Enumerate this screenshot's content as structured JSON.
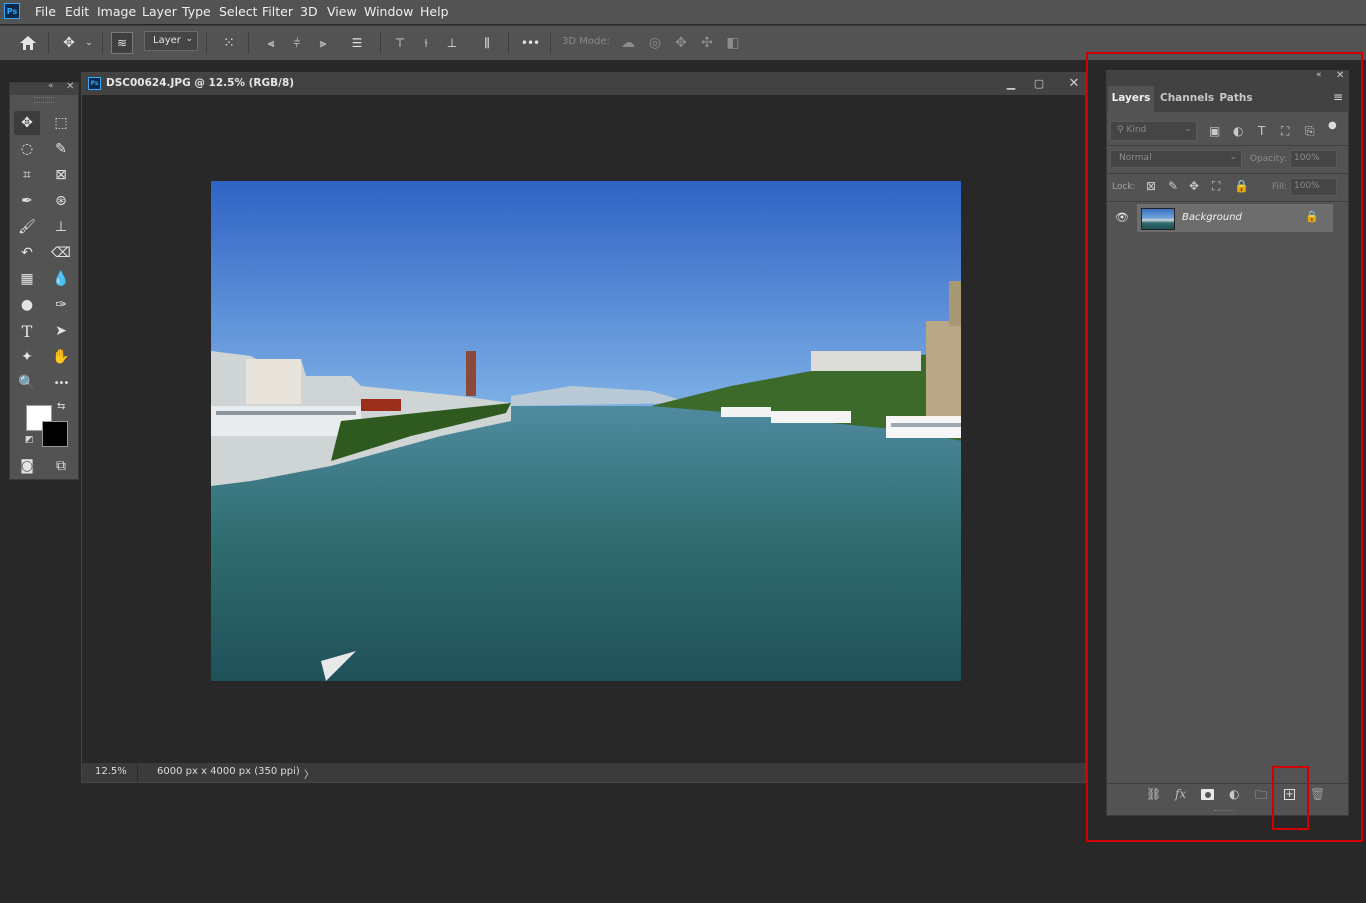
{
  "app": {
    "logo": "Ps"
  },
  "menu": [
    "File",
    "Edit",
    "Image",
    "Layer",
    "Type",
    "Select",
    "Filter",
    "3D",
    "View",
    "Window",
    "Help"
  ],
  "options_bar": {
    "layer_select_value": "Layer",
    "mode_3d_label": "3D Mode:",
    "icons": [
      "home-icon",
      "move-tool-icon",
      "chevron-down-icon",
      "layer-stack-icon",
      "transform-controls-icon",
      "align-left-icon",
      "align-hcenter-icon",
      "align-right-icon",
      "distribute-vertical-icon",
      "align-top-icon",
      "align-vcenter-icon",
      "align-bottom-icon",
      "distribute-horizontal-icon",
      "more-icon",
      "orbit-3d-icon",
      "roll-3d-icon",
      "pan-3d-icon",
      "slide-3d-icon",
      "scale-3d-icon"
    ]
  },
  "document": {
    "title": "DSC00624.JPG @ 12.5% (RGB/8)",
    "zoom": "12.5%",
    "info": "6000 px x 4000 px (350 ppi)",
    "status_arrow": "〉",
    "window_buttons": [
      "minimize-icon",
      "maximize-icon",
      "close-icon"
    ]
  },
  "toolbox": {
    "tools": [
      {
        "name": "move-tool",
        "glyph": "✥",
        "selected": true
      },
      {
        "name": "marquee-tool",
        "glyph": "⬚"
      },
      {
        "name": "lasso-tool",
        "glyph": "◌"
      },
      {
        "name": "quick-selection-tool",
        "glyph": "✎"
      },
      {
        "name": "crop-tool",
        "glyph": "⌗"
      },
      {
        "name": "frame-tool",
        "glyph": "⊠"
      },
      {
        "name": "eyedropper-tool",
        "glyph": "✒"
      },
      {
        "name": "spot-healing-tool",
        "glyph": "⊛"
      },
      {
        "name": "brush-tool",
        "glyph": "🖌"
      },
      {
        "name": "clone-stamp-tool",
        "glyph": "⊥"
      },
      {
        "name": "history-brush-tool",
        "glyph": "↶"
      },
      {
        "name": "eraser-tool",
        "glyph": "⌫"
      },
      {
        "name": "gradient-tool",
        "glyph": "▦"
      },
      {
        "name": "blur-tool",
        "glyph": "💧"
      },
      {
        "name": "dodge-tool",
        "glyph": "●"
      },
      {
        "name": "pen-tool",
        "glyph": "✑"
      },
      {
        "name": "type-tool",
        "glyph": "T"
      },
      {
        "name": "path-selection-tool",
        "glyph": "➤"
      },
      {
        "name": "custom-shape-tool",
        "glyph": "✦"
      },
      {
        "name": "hand-tool",
        "glyph": "✋"
      },
      {
        "name": "zoom-tool",
        "glyph": "🔍"
      },
      {
        "name": "more-tools",
        "glyph": "•••"
      }
    ],
    "foreground_color": "#ffffff",
    "background_color": "#000000"
  },
  "layers_panel": {
    "tabs": [
      "Layers",
      "Channels",
      "Paths"
    ],
    "active_tab": "Layers",
    "filter_placeholder": "Kind",
    "blend_mode": "Normal",
    "opacity_label": "Opacity:",
    "opacity_value": "100%",
    "lock_label": "Lock:",
    "fill_label": "Fill:",
    "fill_value": "100%",
    "layers": [
      {
        "name": "Background",
        "visible": true,
        "locked": true
      }
    ],
    "footer_icons": [
      "link-layers-icon",
      "fx-icon",
      "add-mask-icon",
      "adjustment-layer-icon",
      "group-folder-icon",
      "new-layer-icon",
      "trash-icon"
    ],
    "fx_label": "fx"
  },
  "highlight_color": "#d00000"
}
